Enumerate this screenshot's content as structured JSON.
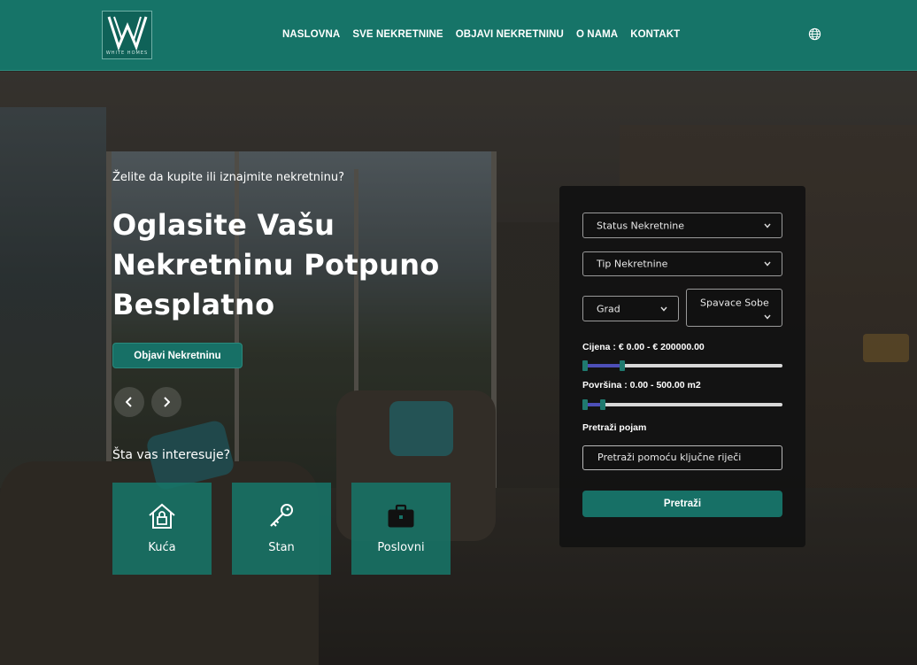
{
  "brand": {
    "logo_text": "WHITE HOMES"
  },
  "nav": {
    "items": [
      "NASLOVNA",
      "SVE NEKRETNINE",
      "OBJAVI NEKRETNINU",
      "O NAMA",
      "KONTAKT"
    ],
    "language_icon": "globe-icon"
  },
  "hero": {
    "subtitle": "Želite da kupite ili iznajmite nekretninu?",
    "headline_lines": [
      "Oglasite Vašu",
      "Nekretninu Potpuno",
      "Besplatno"
    ],
    "cta_label": "Objavi Nekretninu",
    "prev_icon": "chevron-left-icon",
    "next_icon": "chevron-right-icon",
    "interest_title": "Šta vas interesuje?",
    "categories": [
      {
        "label": "Kuća",
        "icon": "house-lock-icon"
      },
      {
        "label": "Stan",
        "icon": "key-icon"
      },
      {
        "label": "Poslovni",
        "icon": "briefcase-icon"
      }
    ]
  },
  "search": {
    "status_label": "Status Nekretnine",
    "type_label": "Tip Nekretnine",
    "city_label": "Grad",
    "bedrooms_label": "Spavace Sobe",
    "price_label": "Cijena : € 0.00 - € 200000.00",
    "price_range_fraction": [
      0.0,
      0.2
    ],
    "area_label": "Površina : 0.00 - 500.00 m2",
    "area_range_fraction": [
      0.0,
      0.1
    ],
    "keyword_title": "Pretraži pojam",
    "keyword_placeholder": "Pretraži pomoću ključne riječi",
    "submit_label": "Pretraži"
  },
  "colors": {
    "primary": "#177066",
    "header": "#167468",
    "panel": "#121212",
    "slider_fill": "#4d4fb8"
  }
}
